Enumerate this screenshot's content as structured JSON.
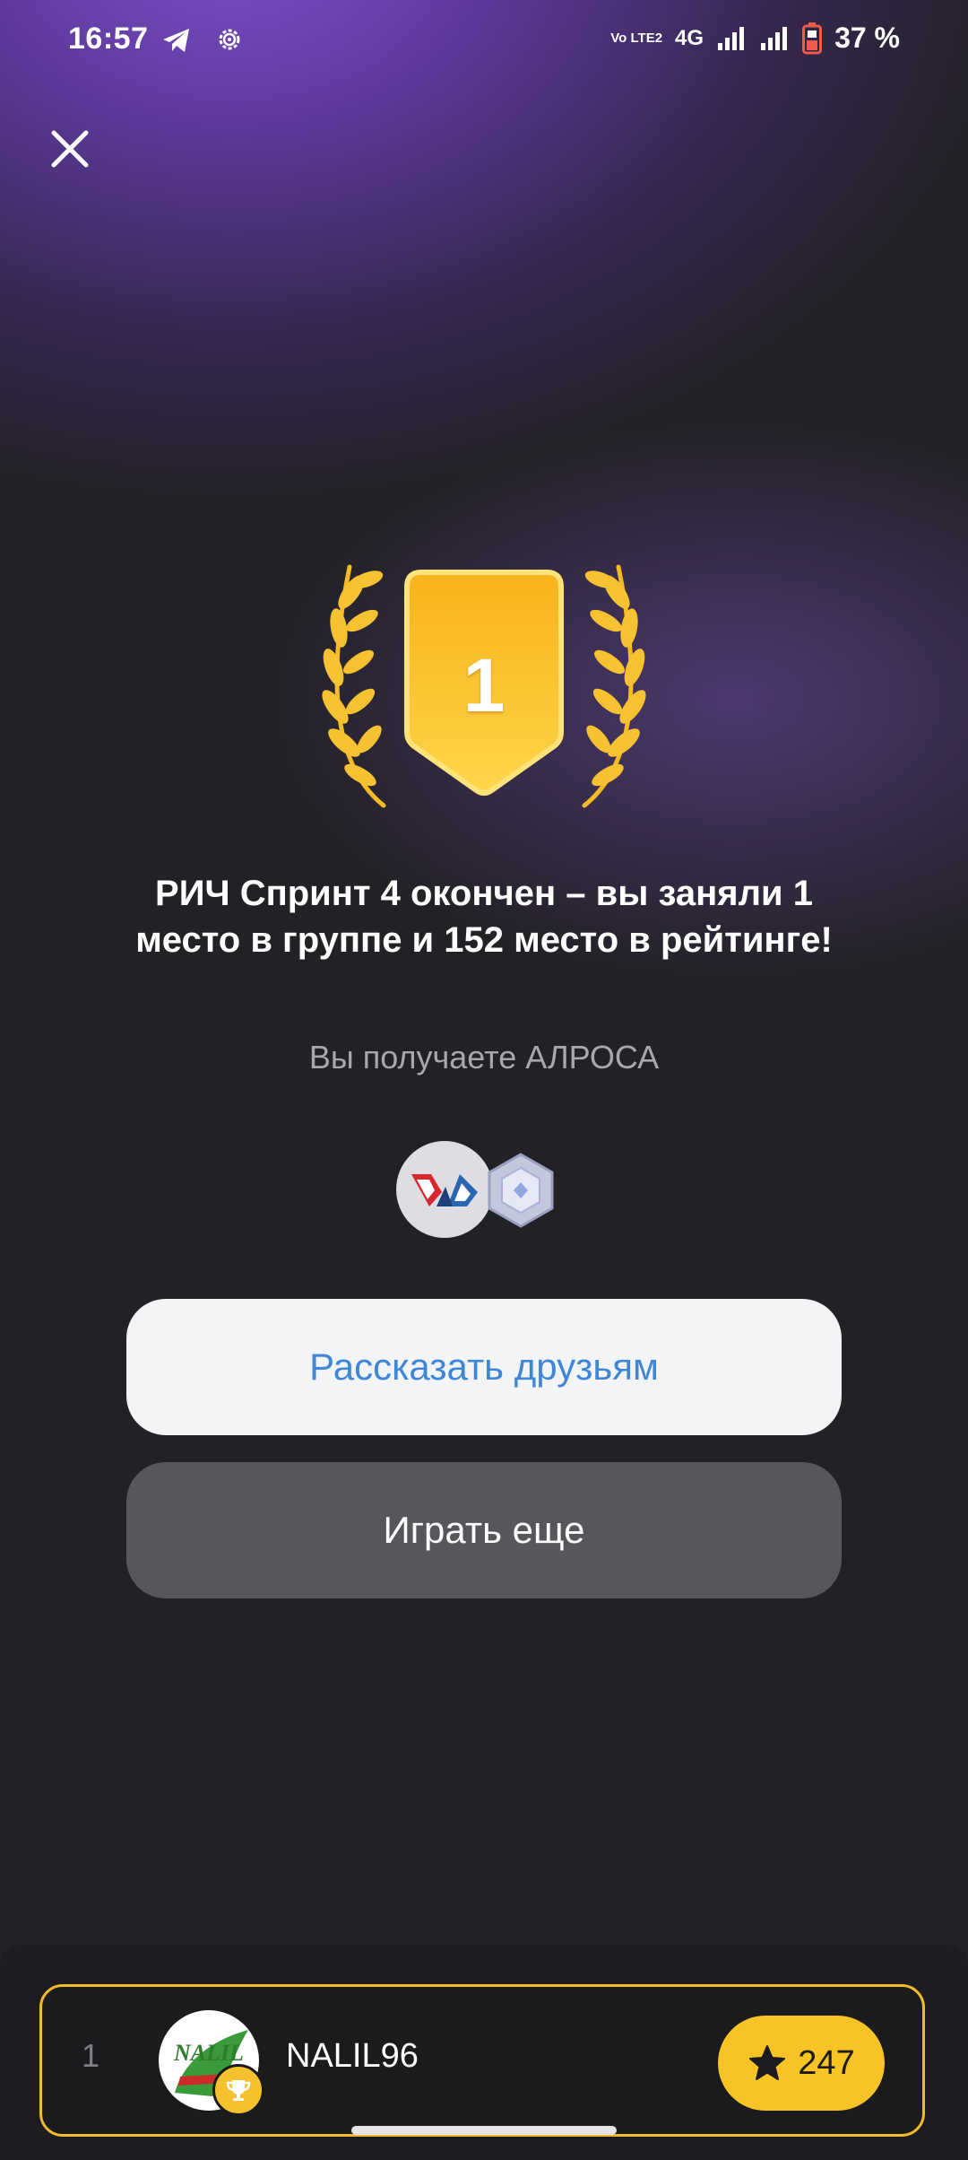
{
  "status_bar": {
    "time": "16:57",
    "network": "4G",
    "volte": "Vo LTE2",
    "battery": "37 %",
    "icons": [
      "telegram-icon",
      "settings-cog-icon",
      "volte-icon",
      "signal-icon",
      "battery-icon"
    ]
  },
  "header": {
    "close_icon": "close-icon"
  },
  "result": {
    "place": "1",
    "title": "РИЧ Спринт 4 окончен – вы заняли 1 место в группе и 152 место в рейтинге!",
    "subtitle": "Вы получаете АЛРОСА"
  },
  "reward": {
    "icons": [
      "alrosa-logo-icon",
      "hexagon-gem-icon"
    ]
  },
  "actions": {
    "share_label": "Рассказать друзьям",
    "play_label": "Играть еще"
  },
  "leaderboard_row": {
    "rank": "1",
    "username": "NALIL96",
    "score": "247",
    "avatar_text": "NALIL",
    "badge_icon": "trophy-icon",
    "score_icon": "star-icon"
  },
  "colors": {
    "accent_gold": "#f7c325",
    "share_text": "#3f86d6",
    "background": "#232126",
    "purple_glow": "#7a4fc8"
  }
}
